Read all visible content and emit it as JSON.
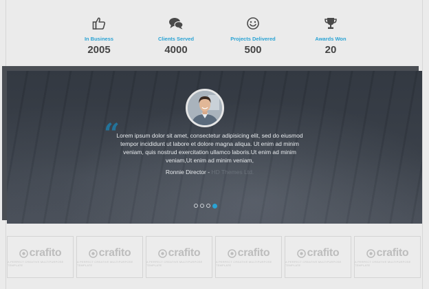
{
  "stats": [
    {
      "icon": "thumbs-up-icon",
      "label": "In Business",
      "value": "2005"
    },
    {
      "icon": "chat-bubbles-icon",
      "label": "Clients Served",
      "value": "4000"
    },
    {
      "icon": "smiley-icon",
      "label": "Projects Delivered",
      "value": "500"
    },
    {
      "icon": "trophy-icon",
      "label": "Awards Won",
      "value": "20"
    }
  ],
  "testimonial": {
    "quote_mark": "“",
    "text": "Lorem ipsum dolor sit amet, consectetur adipisicing elit, sed do eiusmod tempor incididunt ut labore et dolore magna aliqua. Ut enim ad minim veniam, quis nostrud exercitation ullamco laboris.Ut enim ad minim veniam,Ut enim ad minim veniam,",
    "author": "Ronnie Director - ",
    "company": "HD Themes Ltd.",
    "slides": 4,
    "active_slide": 4
  },
  "logos": [
    {
      "name": "crafito",
      "tagline": "A PERFECT CREATIVE MULTIPURPOSE TEMPLATE"
    },
    {
      "name": "crafito",
      "tagline": "A PERFECT CREATIVE MULTIPURPOSE TEMPLATE"
    },
    {
      "name": "crafito",
      "tagline": "A PERFECT CREATIVE MULTIPURPOSE TEMPLATE"
    },
    {
      "name": "crafito",
      "tagline": "A PERFECT CREATIVE MULTIPURPOSE TEMPLATE"
    },
    {
      "name": "crafito",
      "tagline": "A PERFECT CREATIVE MULTIPURPOSE TEMPLATE"
    },
    {
      "name": "crafito",
      "tagline": "A PERFECT CREATIVE MULTIPURPOSE TEMPLATE"
    }
  ],
  "colors": {
    "accent": "#2aa3d4",
    "band": "#363c45",
    "page_bg": "#ebebeb"
  }
}
